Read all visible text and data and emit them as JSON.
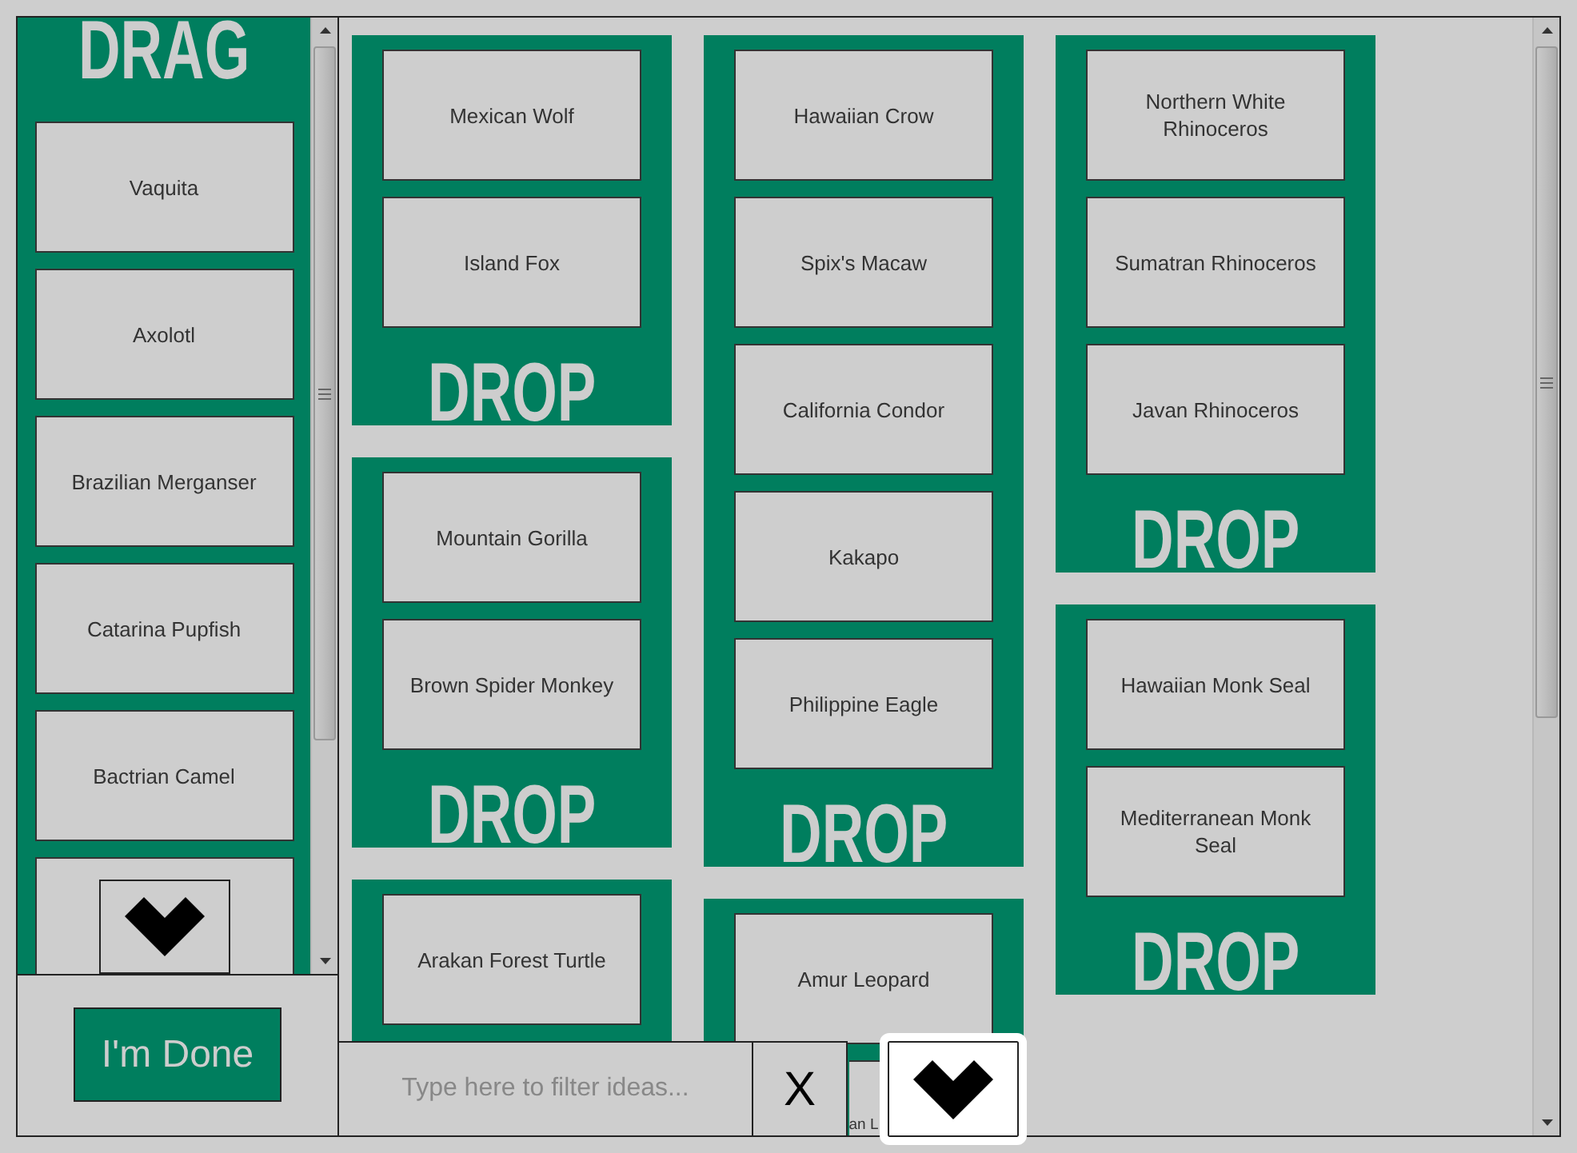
{
  "drag_panel": {
    "title": "DRAG",
    "ideas": [
      "Vaquita",
      "Axolotl",
      "Brazilian Merganser",
      "Catarina Pupfish",
      "Bactrian Camel"
    ]
  },
  "done_button": {
    "label": "I'm Done"
  },
  "drop_columns": [
    {
      "zones": [
        {
          "ideas": [
            "Mexican Wolf",
            "Island Fox"
          ],
          "title": "DROP"
        },
        {
          "ideas": [
            "Mountain Gorilla",
            "Brown Spider Monkey"
          ],
          "title": "DROP"
        },
        {
          "ideas": [
            "Arakan Forest Turtle"
          ]
        }
      ]
    },
    {
      "zones": [
        {
          "ideas": [
            "Hawaiian Crow",
            "Spix's Macaw",
            "California Condor",
            "Kakapo",
            "Philippine Eagle"
          ],
          "title": "DROP"
        },
        {
          "ideas": [
            "Amur Leopard"
          ],
          "cut_idea": "an L"
        }
      ]
    },
    {
      "zones": [
        {
          "ideas": [
            "Northern White Rhinoceros",
            "Sumatran Rhinoceros",
            "Javan Rhinoceros"
          ],
          "title": "DROP"
        },
        {
          "ideas": [
            "Hawaiian Monk Seal",
            "Mediterranean Monk Seal"
          ],
          "title": "DROP"
        }
      ]
    }
  ],
  "filter": {
    "placeholder": "Type here to filter ideas...",
    "clear_button": "X"
  }
}
